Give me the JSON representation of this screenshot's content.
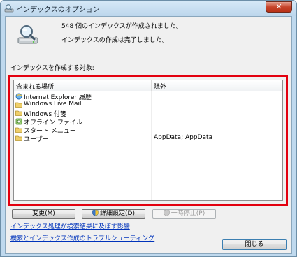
{
  "window": {
    "title": "インデックスのオプション",
    "close_glyph": "✕"
  },
  "status": {
    "indexed_count_text": "548 個のインデックスが作成されました。",
    "complete_text": "インデックスの作成は完了しました。",
    "icon": "magnifier-drive-icon"
  },
  "list": {
    "label": "インデックスを作成する対象:",
    "columns": [
      "含まれる場所",
      "除外"
    ],
    "rows": [
      {
        "name": "Internet Explorer 履歴",
        "exclude": "",
        "icon": "ie-history-icon"
      },
      {
        "name": "Windows Live Mail",
        "exclude": "",
        "icon": "folder-icon"
      },
      {
        "name": "Windows 付箋",
        "exclude": "",
        "icon": "folder-icon"
      },
      {
        "name": "オフライン ファイル",
        "exclude": "",
        "icon": "offline-files-icon"
      },
      {
        "name": "スタート メニュー",
        "exclude": "",
        "icon": "folder-icon"
      },
      {
        "name": "ユーザー",
        "exclude": "AppData; AppData",
        "icon": "folder-icon"
      }
    ]
  },
  "buttons": {
    "modify": "変更(M)",
    "advanced": "詳細設定(D)",
    "pause": "一時停止(P)",
    "close": "閉じる"
  },
  "links": {
    "affects": "インデックス処理が検索結果に及ぼす影響",
    "troubleshoot": "検索とインデックス作成のトラブルシューティング"
  }
}
